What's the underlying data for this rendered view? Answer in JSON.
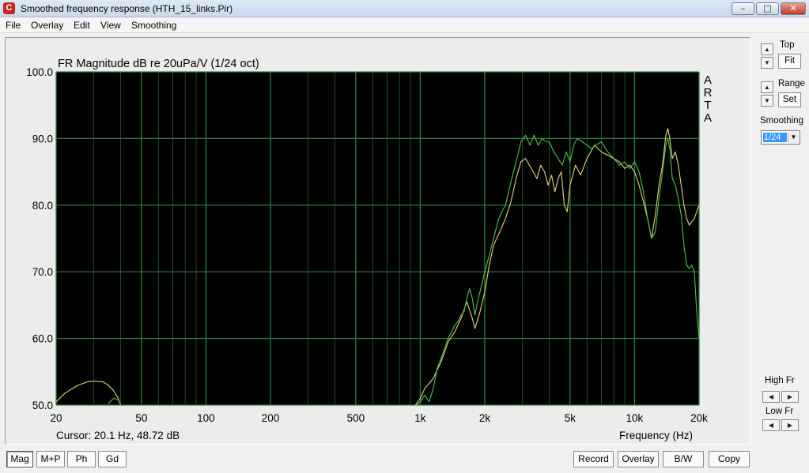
{
  "window": {
    "title": "Smoothed frequency response (HTH_15_links.Pir)",
    "app_icon": "arta-app-icon",
    "controls": {
      "minimize": "–",
      "maximize": "□",
      "close": "✕"
    }
  },
  "menu": [
    "File",
    "Overlay",
    "Edit",
    "View",
    "Smoothing"
  ],
  "plot": {
    "title": "FR Magnitude dB re 20uPa/V (1/24 oct)",
    "watermark": [
      "A",
      "R",
      "T",
      "A"
    ],
    "cursor_readout": "Cursor: 20.1 Hz, 48.72 dB",
    "background": "#000000",
    "grid_color": "#2f7f3f"
  },
  "chart_data": {
    "type": "line",
    "title": "FR Magnitude dB re 20uPa/V (1/24 oct)",
    "xlabel": "Frequency (Hz)",
    "ylabel": "",
    "x_scale": "log",
    "xlim": [
      20,
      20000
    ],
    "ylim": [
      50,
      100
    ],
    "x_ticks": [
      20,
      50,
      100,
      200,
      500,
      1000,
      2000,
      5000,
      10000,
      20000
    ],
    "x_tick_labels": [
      "20",
      "50",
      "100",
      "200",
      "500",
      "1k",
      "2k",
      "5k",
      "10k",
      "20k"
    ],
    "y_ticks": [
      50,
      60,
      70,
      80,
      90,
      100
    ],
    "y_tick_labels": [
      "50.0",
      "60.0",
      "70.0",
      "80.0",
      "90.0",
      "100.0"
    ],
    "grid": true,
    "series": [
      {
        "color": "#e6d77a",
        "x": [
          20,
          22,
          25,
          28,
          30,
          33,
          35,
          37,
          39,
          40,
          950,
          1000,
          1050,
          1150,
          1250,
          1350,
          1450,
          1550,
          1650,
          1750,
          1800,
          1900,
          2000,
          2100,
          2200,
          2350,
          2500,
          2650,
          2800,
          2950,
          3100,
          3300,
          3500,
          3650,
          3800,
          3950,
          4100,
          4250,
          4400,
          4550,
          4700,
          4850,
          5000,
          5300,
          5600,
          6000,
          6500,
          7000,
          7500,
          8000,
          8500,
          9000,
          9500,
          10000,
          10500,
          11000,
          11500,
          12000,
          12500,
          13000,
          13500,
          14000,
          14300,
          14600,
          15000,
          15500,
          16000,
          16500,
          17000,
          17500,
          18000,
          19000,
          20000
        ],
        "y": [
          50.5,
          51.8,
          52.9,
          53.5,
          53.6,
          53.5,
          53.0,
          52.2,
          51.0,
          50.0,
          50.0,
          51.0,
          52.5,
          54.0,
          56.5,
          59.5,
          61.0,
          63.0,
          65.5,
          63.0,
          61.5,
          64.0,
          67.0,
          71.0,
          74.0,
          76.0,
          78.0,
          80.5,
          84.0,
          86.5,
          87.0,
          85.5,
          84.0,
          86.0,
          85.0,
          83.0,
          84.5,
          82.0,
          84.0,
          85.0,
          80.0,
          79.0,
          83.0,
          86.0,
          84.5,
          87.0,
          89.0,
          88.0,
          87.5,
          87.0,
          86.5,
          85.5,
          86.0,
          85.0,
          83.0,
          80.5,
          78.0,
          75.0,
          78.5,
          83.0,
          86.0,
          90.5,
          91.5,
          90.0,
          87.0,
          88.0,
          86.0,
          83.0,
          80.0,
          78.0,
          77.0,
          78.0,
          80.0
        ]
      },
      {
        "color": "#4ec24e",
        "x": [
          35,
          37,
          39,
          40,
          960,
          1000,
          1050,
          1100,
          1150,
          1200,
          1250,
          1300,
          1350,
          1400,
          1450,
          1500,
          1550,
          1600,
          1650,
          1700,
          1750,
          1800,
          1850,
          1900,
          2000,
          2100,
          2200,
          2300,
          2400,
          2500,
          2650,
          2800,
          2950,
          3100,
          3250,
          3400,
          3550,
          3700,
          3850,
          4000,
          4200,
          4400,
          4600,
          4800,
          5000,
          5200,
          5400,
          5700,
          6000,
          6300,
          6600,
          7000,
          7500,
          8000,
          8500,
          9000,
          9500,
          10000,
          10500,
          11000,
          11500,
          12000,
          12500,
          13000,
          13500,
          14000,
          14300,
          14600,
          15000,
          15500,
          16000,
          16500,
          17000,
          17500,
          18000,
          18500,
          19000,
          19500,
          20000
        ],
        "y": [
          50.2,
          51.0,
          50.8,
          50.0,
          50.0,
          50.5,
          51.5,
          50.5,
          52.5,
          55.5,
          57.0,
          58.5,
          60.0,
          61.0,
          62.0,
          62.5,
          63.5,
          64.0,
          66.0,
          67.5,
          66.0,
          63.5,
          65.5,
          67.0,
          70.0,
          72.5,
          75.0,
          77.5,
          79.0,
          80.0,
          83.5,
          86.5,
          89.5,
          90.5,
          89.0,
          90.5,
          89.0,
          90.0,
          89.5,
          89.5,
          88.0,
          87.0,
          86.0,
          88.0,
          86.5,
          89.0,
          90.0,
          89.5,
          89.0,
          88.5,
          89.0,
          89.5,
          88.0,
          87.0,
          86.0,
          86.5,
          85.5,
          86.5,
          85.0,
          82.0,
          78.0,
          75.0,
          76.0,
          81.0,
          85.0,
          89.0,
          90.0,
          88.5,
          84.0,
          83.0,
          81.0,
          78.5,
          74.0,
          71.0,
          70.5,
          71.0,
          70.0,
          64.0,
          60.0
        ]
      }
    ]
  },
  "side": {
    "top_label": "Top",
    "fit_btn": "Fit",
    "range_label": "Range",
    "set_btn": "Set",
    "smoothing_label": "Smoothing",
    "smoothing_value": "1/24",
    "high_fr_label": "High Fr",
    "low_fr_label": "Low Fr",
    "up_arrow": "▲",
    "down_arrow": "▼",
    "left_arrow": "◀",
    "right_arrow": "▶"
  },
  "buttons": {
    "mag": "Mag",
    "mp": "M+P",
    "ph": "Ph",
    "gd": "Gd",
    "record": "Record",
    "overlay": "Overlay",
    "bw": "B/W",
    "copy": "Copy"
  }
}
